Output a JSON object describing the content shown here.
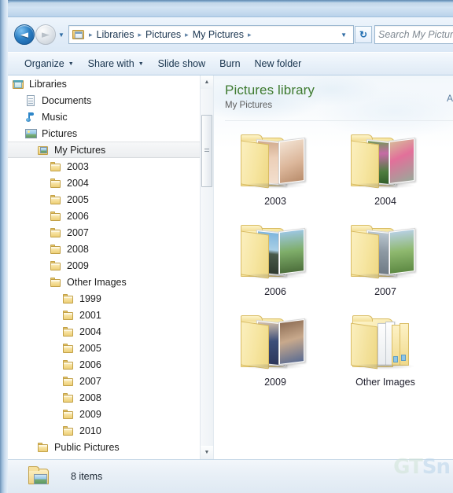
{
  "window": {
    "title": ""
  },
  "addressbar": {
    "back_label": "Back",
    "forward_label": "Forward",
    "history_label": "Recent pages",
    "crumbs": [
      "Libraries",
      "Pictures",
      "My Pictures"
    ],
    "separator": "▸",
    "refresh_label": "↻",
    "search": {
      "placeholder": "Search My Pictur",
      "value": ""
    }
  },
  "toolbar": {
    "items": [
      {
        "label": "Organize",
        "has_caret": true
      },
      {
        "label": "Share with",
        "has_caret": true
      },
      {
        "label": "Slide show",
        "has_caret": false
      },
      {
        "label": "Burn",
        "has_caret": false
      },
      {
        "label": "New folder",
        "has_caret": false
      }
    ]
  },
  "navpane": {
    "items": [
      {
        "label": "Libraries",
        "indent": 0,
        "icon": "library-icon",
        "selected": false
      },
      {
        "label": "Documents",
        "indent": 1,
        "icon": "document-icon",
        "selected": false
      },
      {
        "label": "Music",
        "indent": 1,
        "icon": "music-icon",
        "selected": false
      },
      {
        "label": "Pictures",
        "indent": 1,
        "icon": "picture-icon",
        "selected": false
      },
      {
        "label": "My Pictures",
        "indent": 2,
        "icon": "my-pictures-icon",
        "selected": true
      },
      {
        "label": "2003",
        "indent": 3,
        "icon": "folder-icon",
        "selected": false
      },
      {
        "label": "2004",
        "indent": 3,
        "icon": "folder-icon",
        "selected": false
      },
      {
        "label": "2005",
        "indent": 3,
        "icon": "folder-icon",
        "selected": false
      },
      {
        "label": "2006",
        "indent": 3,
        "icon": "folder-icon",
        "selected": false
      },
      {
        "label": "2007",
        "indent": 3,
        "icon": "folder-icon",
        "selected": false
      },
      {
        "label": "2008",
        "indent": 3,
        "icon": "folder-icon",
        "selected": false
      },
      {
        "label": "2009",
        "indent": 3,
        "icon": "folder-icon",
        "selected": false
      },
      {
        "label": "Other Images",
        "indent": 3,
        "icon": "folder-icon",
        "selected": false
      },
      {
        "label": "1999",
        "indent": 4,
        "icon": "folder-icon",
        "selected": false
      },
      {
        "label": "2001",
        "indent": 4,
        "icon": "folder-icon",
        "selected": false
      },
      {
        "label": "2004",
        "indent": 4,
        "icon": "folder-icon",
        "selected": false
      },
      {
        "label": "2005",
        "indent": 4,
        "icon": "folder-icon",
        "selected": false
      },
      {
        "label": "2006",
        "indent": 4,
        "icon": "folder-icon",
        "selected": false
      },
      {
        "label": "2007",
        "indent": 4,
        "icon": "folder-icon",
        "selected": false
      },
      {
        "label": "2008",
        "indent": 4,
        "icon": "folder-icon",
        "selected": false
      },
      {
        "label": "2009",
        "indent": 4,
        "icon": "folder-icon",
        "selected": false
      },
      {
        "label": "2010",
        "indent": 4,
        "icon": "folder-icon",
        "selected": false
      },
      {
        "label": "Public Pictures",
        "indent": 2,
        "icon": "folder-icon",
        "selected": false
      }
    ],
    "scrollbar": {
      "up_glyph": "▲",
      "down_glyph": "▼"
    }
  },
  "content": {
    "header": {
      "title": "Pictures library",
      "subtitle": "My Pictures",
      "arrange_label": "Ar"
    },
    "folders": [
      {
        "name": "2003",
        "icon": "photo-folder-icon"
      },
      {
        "name": "2004",
        "icon": "photo-folder-icon"
      },
      {
        "name": "2006",
        "icon": "photo-folder-icon"
      },
      {
        "name": "2007",
        "icon": "photo-folder-icon"
      },
      {
        "name": "2009",
        "icon": "photo-folder-icon"
      },
      {
        "name": "Other Images",
        "icon": "stacked-folder-icon"
      }
    ]
  },
  "statusbar": {
    "item_count": "8 items",
    "watermark": "GTSn"
  },
  "colors": {
    "library_title": "#3d7a2e",
    "frame": "#a9c7e4",
    "folder_yellow": "#f5dd96",
    "selection": "#eceef0"
  }
}
